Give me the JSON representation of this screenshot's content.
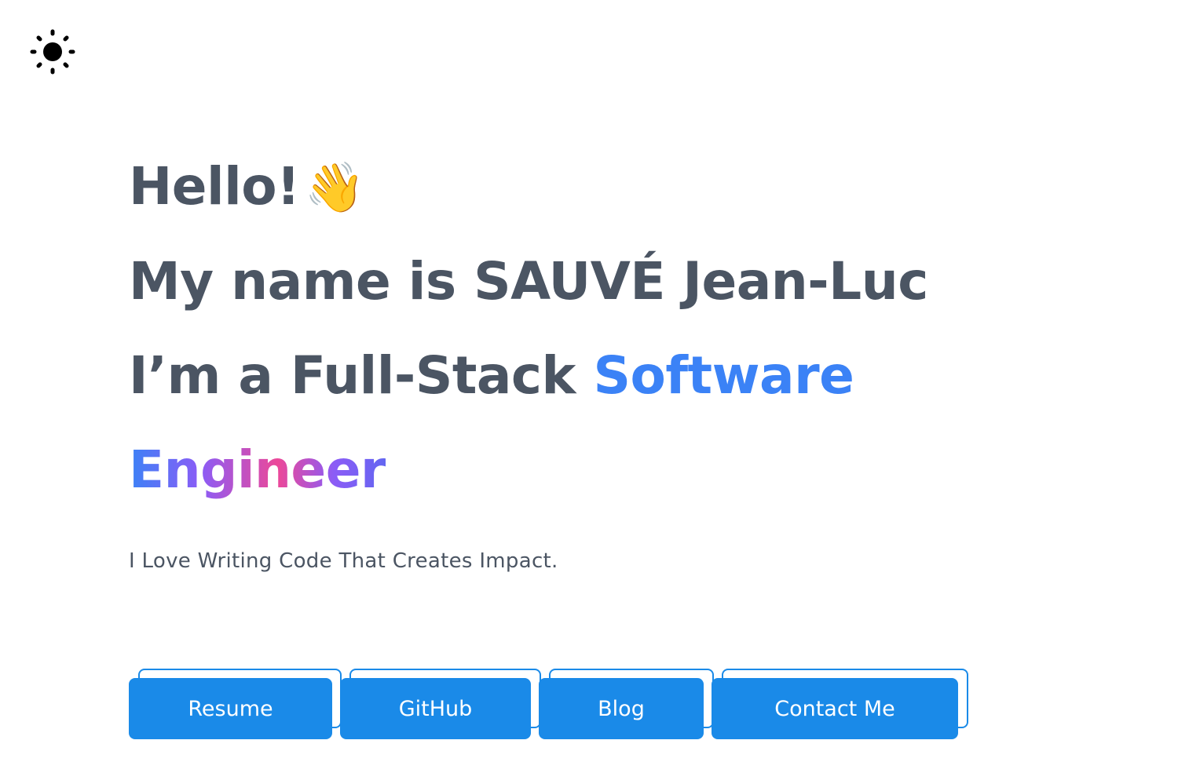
{
  "theme_toggle": {
    "icon": "sun-icon"
  },
  "hero": {
    "greeting": "Hello!",
    "wave_emoji": "👋",
    "name_line": "My name is SAUVÉ Jean-Luc",
    "role_prefix": "I’m a Full-Stack",
    "role_highlight": "Software",
    "role_gradient": "Engineer",
    "tagline": "I Love Writing Code That Creates Impact."
  },
  "actions": {
    "resume": "Resume",
    "github": "GitHub",
    "blog": "Blog",
    "contact": "Contact Me"
  },
  "colors": {
    "text": "#4b5563",
    "accent": "#3b82f6",
    "button": "#1a8ae8",
    "gradient": [
      "#3b82f6",
      "#8b5cf6",
      "#ec4899",
      "#6366f1"
    ]
  }
}
